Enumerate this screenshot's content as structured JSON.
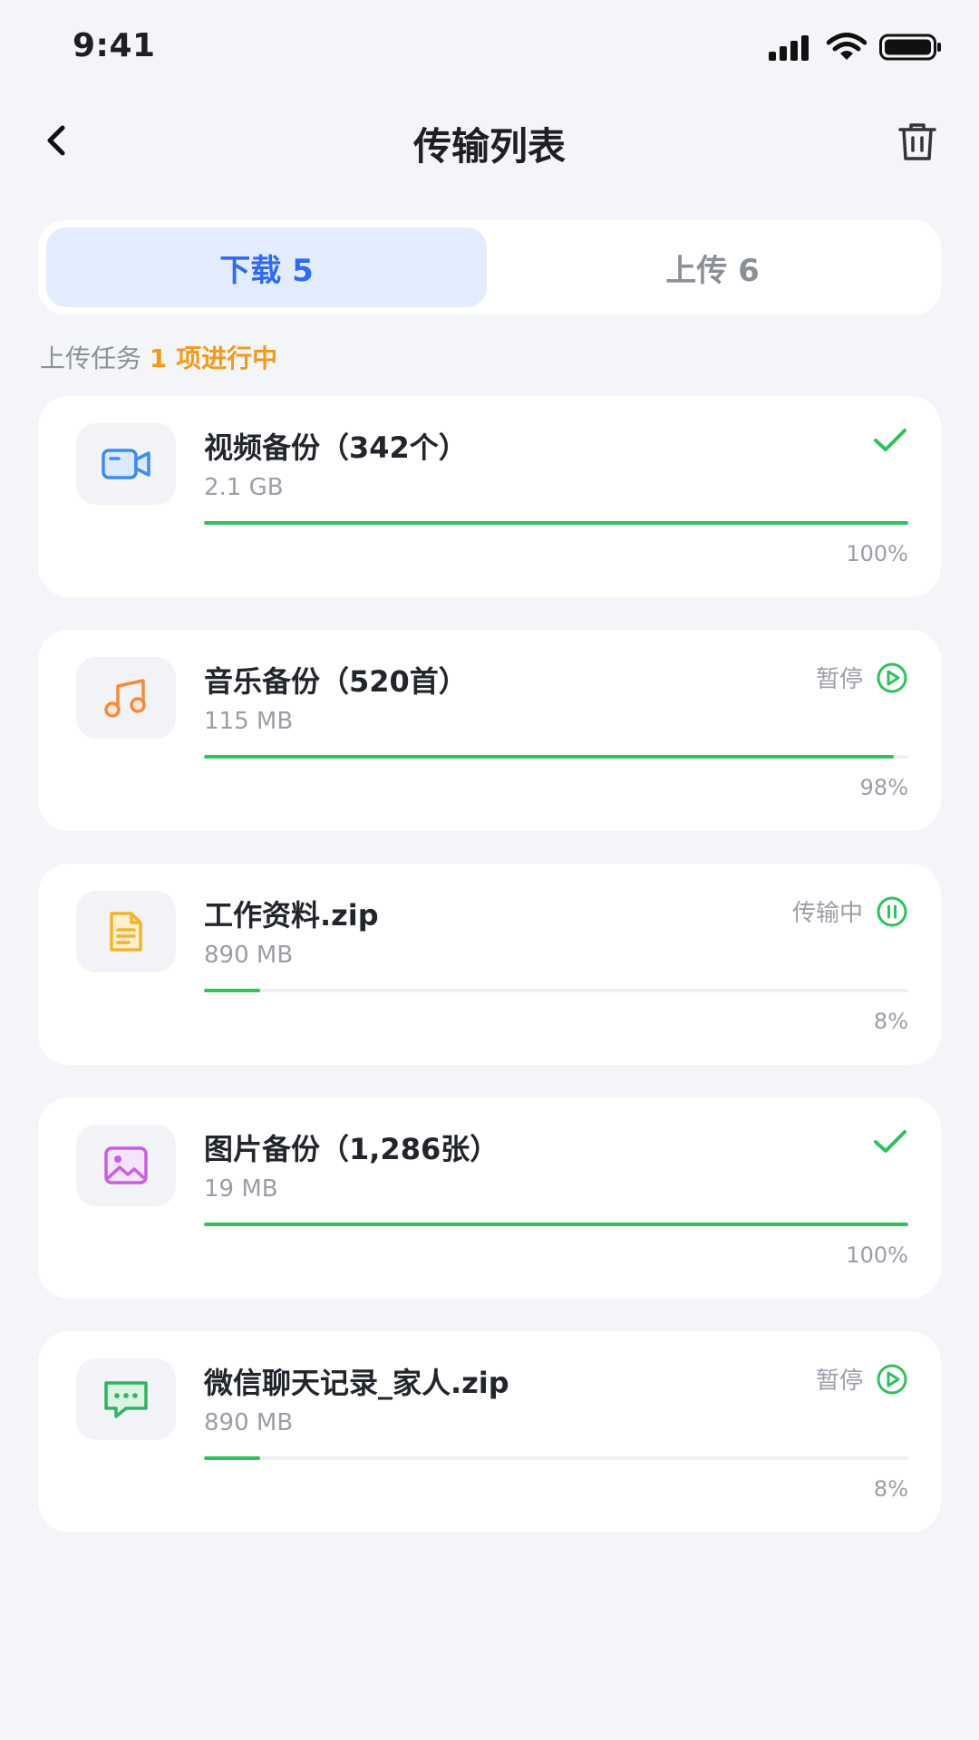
{
  "status_bar": {
    "time": "9:41"
  },
  "nav": {
    "title": "传输列表"
  },
  "tabs": [
    {
      "label": "下载 5",
      "active": true
    },
    {
      "label": "上传 6",
      "active": false
    }
  ],
  "summary": {
    "prefix": "上传任务",
    "highlight": "1 项进行中"
  },
  "colors": {
    "accent": "#2f6bf2",
    "progress": "#2ec25a",
    "highlight": "#f29a1a"
  },
  "items": [
    {
      "icon": "video-icon",
      "name": "视频备份（342个）",
      "size": "2.1 GB",
      "status_label": "",
      "status_icon": "check-icon",
      "progress": 1.0,
      "percent": "100%"
    },
    {
      "icon": "music-icon",
      "name": "音乐备份（520首）",
      "size": "115 MB",
      "status_label": "暂停",
      "status_icon": "play-circle-icon",
      "progress": 0.98,
      "percent": "98%"
    },
    {
      "icon": "document-icon",
      "name": "工作资料.zip",
      "size": "890 MB",
      "status_label": "传输中",
      "status_icon": "pause-circle-icon",
      "progress": 0.08,
      "percent": "8%"
    },
    {
      "icon": "image-icon",
      "name": "图片备份（1,286张）",
      "size": "19 MB",
      "status_label": "",
      "status_icon": "check-icon",
      "progress": 1.0,
      "percent": "100%"
    },
    {
      "icon": "chat-icon",
      "name": "微信聊天记录_家人.zip",
      "size": "890 MB",
      "status_label": "暂停",
      "status_icon": "play-circle-icon",
      "progress": 0.08,
      "percent": "8%"
    }
  ]
}
